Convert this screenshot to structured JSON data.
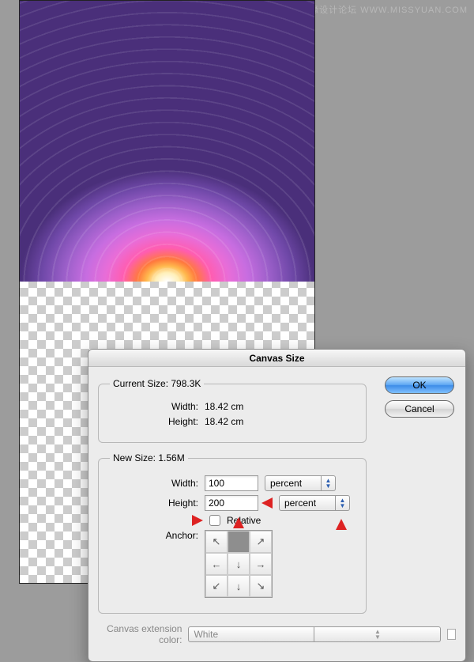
{
  "watermark": "思缘设计论坛  WWW.MISSYUAN.COM",
  "dialog": {
    "title": "Canvas Size",
    "currentSize": {
      "legend": "Current Size:",
      "sizeValue": "798.3K",
      "widthLabel": "Width:",
      "widthValue": "18.42 cm",
      "heightLabel": "Height:",
      "heightValue": "18.42 cm"
    },
    "newSize": {
      "legend": "New Size:",
      "sizeValue": "1.56M",
      "widthLabel": "Width:",
      "widthValue": "100",
      "widthUnit": "percent",
      "heightLabel": "Height:",
      "heightValue": "200",
      "heightUnit": "percent",
      "relativeLabel": "Relative",
      "anchorLabel": "Anchor:"
    },
    "extension": {
      "label": "Canvas extension color:",
      "value": "White"
    },
    "buttons": {
      "ok": "OK",
      "cancel": "Cancel"
    }
  }
}
